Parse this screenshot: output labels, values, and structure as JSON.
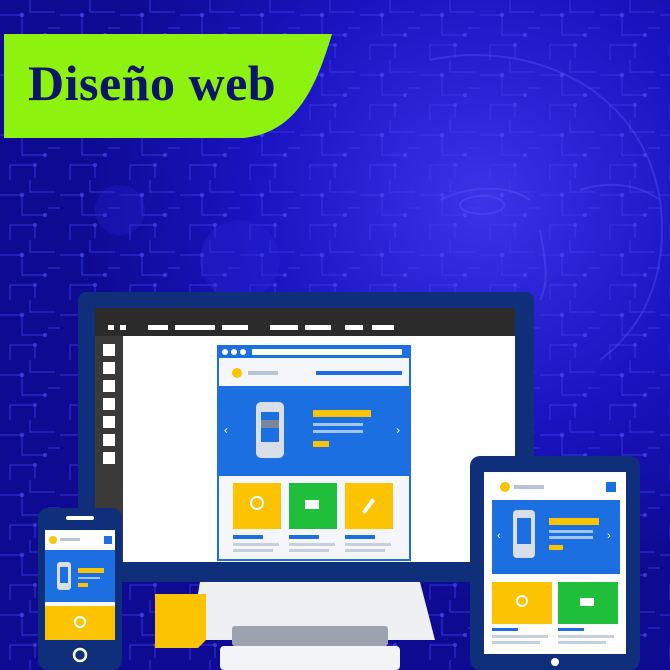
{
  "banner": {
    "title": "Diseño web",
    "bg_color": "#8ef20f",
    "text_color": "#0b1569"
  },
  "background": {
    "color": "#1612b8",
    "motif": "circuit-board-face"
  },
  "illustration": {
    "devices": [
      "desktop-monitor",
      "tablet",
      "smartphone"
    ],
    "accent_colors": {
      "blue": "#1c6fe0",
      "yellow": "#fbc300",
      "green": "#1fbf3c",
      "frame": "#0f2f7a"
    }
  }
}
